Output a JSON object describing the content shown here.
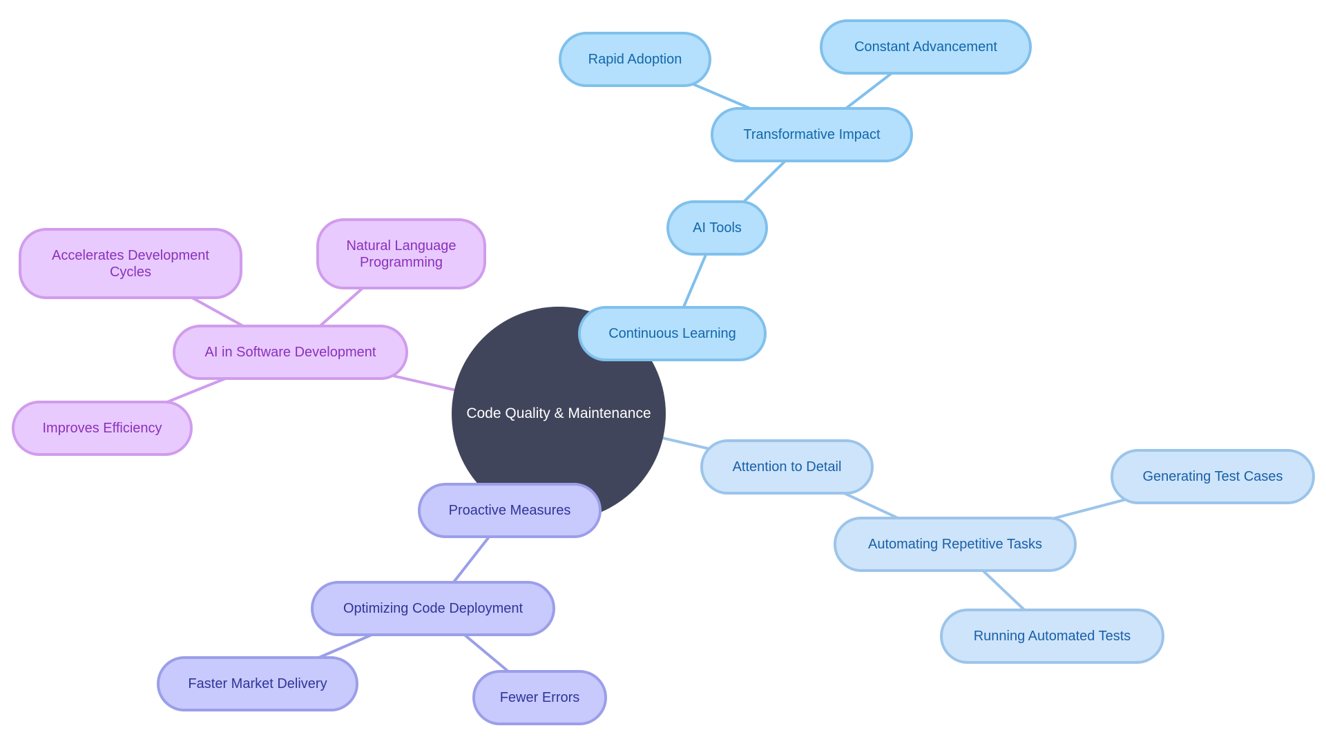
{
  "diagram": {
    "type": "mindmap",
    "root": {
      "id": "root",
      "label": "Code Quality & Maintenance"
    },
    "colors": {
      "root_fill": "#41455b",
      "purple": {
        "fill": "#e8caff",
        "stroke": "#d09cec",
        "text": "#8a31b9"
      },
      "sky": {
        "fill": "#b4e0fd",
        "stroke": "#80c0ec",
        "text": "#1466a8"
      },
      "light": {
        "fill": "#cde4fa",
        "stroke": "#9cc4ea",
        "text": "#1a5fa8"
      },
      "indigo": {
        "fill": "#c8c9fc",
        "stroke": "#9b9ee8",
        "text": "#2e3597"
      }
    },
    "nodes": [
      {
        "id": "ai-dev",
        "label": "AI in Software Development",
        "parent": "root",
        "theme": "purple"
      },
      {
        "id": "accel",
        "label": "Accelerates Development Cycles",
        "parent": "ai-dev",
        "theme": "purple"
      },
      {
        "id": "nlp",
        "label": "Natural Language Programming",
        "parent": "ai-dev",
        "theme": "purple"
      },
      {
        "id": "eff",
        "label": "Improves Efficiency",
        "parent": "ai-dev",
        "theme": "purple"
      },
      {
        "id": "cont",
        "label": "Continuous Learning",
        "parent": "root",
        "theme": "sky"
      },
      {
        "id": "aitools",
        "label": "AI Tools",
        "parent": "cont",
        "theme": "sky"
      },
      {
        "id": "trans",
        "label": "Transformative Impact",
        "parent": "aitools",
        "theme": "sky"
      },
      {
        "id": "rapid",
        "label": "Rapid Adoption",
        "parent": "trans",
        "theme": "sky"
      },
      {
        "id": "constadv",
        "label": "Constant Advancement",
        "parent": "trans",
        "theme": "sky"
      },
      {
        "id": "attn",
        "label": "Attention to Detail",
        "parent": "root",
        "theme": "light"
      },
      {
        "id": "auto",
        "label": "Automating Repetitive Tasks",
        "parent": "attn",
        "theme": "light"
      },
      {
        "id": "gen",
        "label": "Generating Test Cases",
        "parent": "auto",
        "theme": "light"
      },
      {
        "id": "run",
        "label": "Running Automated Tests",
        "parent": "auto",
        "theme": "light"
      },
      {
        "id": "pro",
        "label": "Proactive Measures",
        "parent": "root",
        "theme": "indigo"
      },
      {
        "id": "opt",
        "label": "Optimizing Code Deployment",
        "parent": "pro",
        "theme": "indigo"
      },
      {
        "id": "faster",
        "label": "Faster Market Delivery",
        "parent": "opt",
        "theme": "indigo"
      },
      {
        "id": "fewer",
        "label": "Fewer Errors",
        "parent": "opt",
        "theme": "indigo"
      }
    ]
  }
}
